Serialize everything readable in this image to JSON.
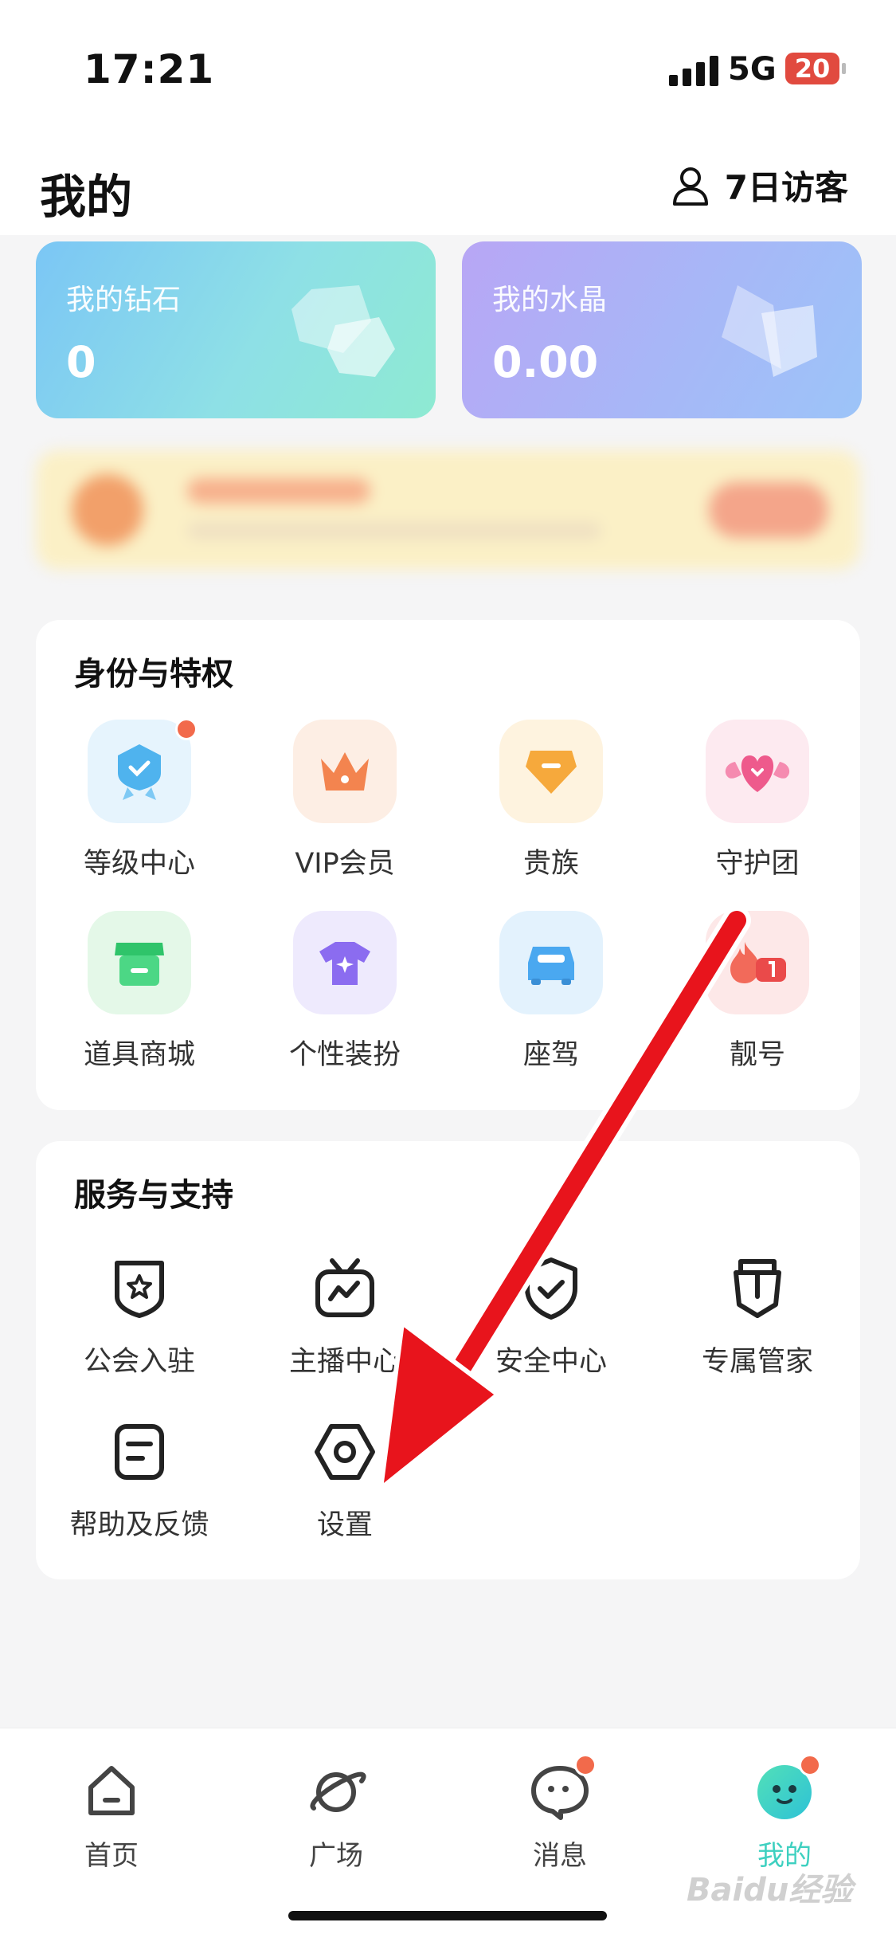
{
  "status_bar": {
    "time": "17:21",
    "network": "5G",
    "battery": "20"
  },
  "header": {
    "title": "我的",
    "visitors_label": "7日访客"
  },
  "wallet": {
    "diamond": {
      "label": "我的钻石",
      "value": "0"
    },
    "crystal": {
      "label": "我的水晶",
      "value": "0.00"
    }
  },
  "identity": {
    "title": "身份与特权",
    "items": [
      {
        "label": "等级中心",
        "icon": "level-badge-icon"
      },
      {
        "label": "VIP会员",
        "icon": "crown-icon"
      },
      {
        "label": "贵族",
        "icon": "noble-gem-icon"
      },
      {
        "label": "守护团",
        "icon": "winged-heart-icon"
      },
      {
        "label": "道具商城",
        "icon": "shop-icon"
      },
      {
        "label": "个性装扮",
        "icon": "shirt-icon"
      },
      {
        "label": "座驾",
        "icon": "car-icon"
      },
      {
        "label": "靓号",
        "icon": "fire-number-icon"
      }
    ]
  },
  "services": {
    "title": "服务与支持",
    "items": [
      {
        "label": "公会入驻",
        "icon": "guild-shield-icon"
      },
      {
        "label": "主播中心",
        "icon": "tv-icon"
      },
      {
        "label": "安全中心",
        "icon": "security-shield-icon"
      },
      {
        "label": "专属管家",
        "icon": "butler-tag-icon"
      },
      {
        "label": "帮助及反馈",
        "icon": "feedback-icon"
      },
      {
        "label": "设置",
        "icon": "settings-hexagon-icon"
      }
    ]
  },
  "tabs": [
    {
      "label": "首页",
      "icon": "home-icon"
    },
    {
      "label": "广场",
      "icon": "planet-icon"
    },
    {
      "label": "消息",
      "icon": "message-icon"
    },
    {
      "label": "我的",
      "icon": "profile-avatar-icon",
      "active": true
    }
  ],
  "watermark": "Baidu经验",
  "colors": {
    "accent": "#3ed0c0",
    "badge": "#f26a4b",
    "annotation_arrow": "#e8141c"
  }
}
